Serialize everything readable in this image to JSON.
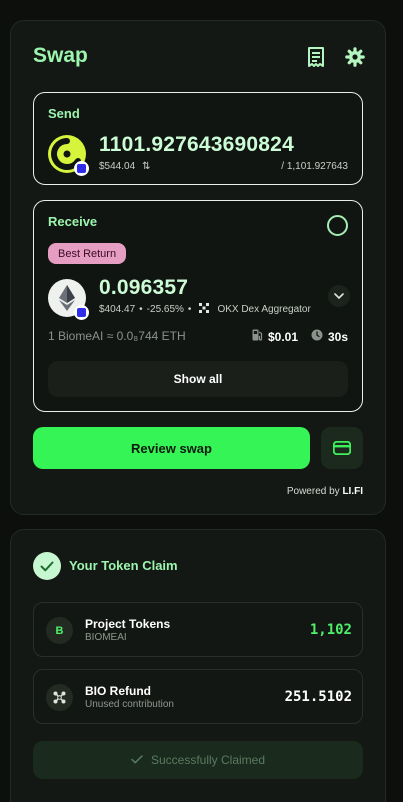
{
  "swap": {
    "title": "Swap",
    "send": {
      "label": "Send",
      "amount": "1101.927643690824",
      "usd": "$544.04",
      "switch_glyph": "⇅",
      "balance": "/ 1,101.927643"
    },
    "receive": {
      "label": "Receive",
      "badge": "Best Return",
      "amount": "0.096357",
      "usd": "$404.47",
      "dot1": "•",
      "change": "-25.65%",
      "dot2": "•",
      "aggregator": "OKX Dex Aggregator",
      "rate": "1 BiomeAI ≈ 0.0₈744 ETH",
      "gas": "$0.01",
      "time": "30s",
      "show_all": "Show all"
    },
    "review_label": "Review swap",
    "powered_prefix": "Powered by",
    "powered_brand": "LI.FI"
  },
  "claim": {
    "title": "Your Token Claim",
    "rows": [
      {
        "icon_letter": "B",
        "name": "Project Tokens",
        "sub": "BIOMEAI",
        "value": "1,102"
      },
      {
        "name": "BIO Refund",
        "sub": "Unused contribution",
        "value": "251.5102"
      }
    ],
    "claimed_label": "Successfully Claimed"
  },
  "icons": {
    "header": [
      "receipt-icon",
      "gear-icon"
    ],
    "tokens": [
      "biomeai-token-icon",
      "ethereum-token-icon",
      "chain-badge-icon"
    ],
    "misc": [
      "swap-switch-icon",
      "okx-logo-icon",
      "chevron-down-icon",
      "gas-pump-icon",
      "clock-icon",
      "wallet-icon",
      "check-circle-icon",
      "check-icon",
      "refund-icon"
    ]
  },
  "colors": {
    "accent_green": "#35f556",
    "title_mint": "#9cf5ae",
    "best_return_pink": "#e59dc1",
    "chain_blue": "#2f2de8",
    "biome_yellow": "#d6f43b"
  }
}
